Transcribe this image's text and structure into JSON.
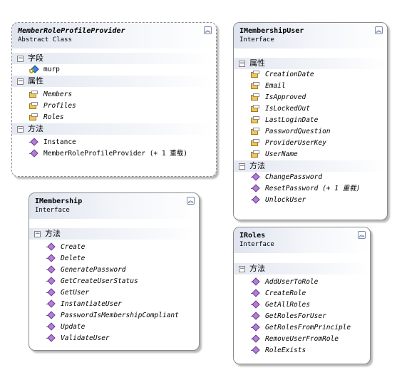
{
  "boxes": {
    "member_role_profile_provider": {
      "title": "MemberRoleProfileProvider",
      "subtitle": "Abstract Class",
      "collapse_glyph": "︽",
      "fields_label": "字段",
      "fields": [
        "murp"
      ],
      "properties_label": "属性",
      "properties": [
        "Members",
        "Profiles",
        "Roles"
      ],
      "methods_label": "方法",
      "methods": [
        "Instance",
        "MemberRoleProfileProvider (+ 1 重载)"
      ]
    },
    "imembership_user": {
      "title": "IMembershipUser",
      "subtitle": "Interface",
      "collapse_glyph": "︽",
      "properties_label": "属性",
      "properties": [
        "CreationDate",
        "Email",
        "IsApproved",
        "IsLockedOut",
        "LastLoginDate",
        "PasswordQuestion",
        "ProviderUserKey",
        "UserName"
      ],
      "methods_label": "方法",
      "methods": [
        "ChangePassword",
        "ResetPassword (+ 1 重载)",
        "UnlockUser"
      ]
    },
    "imembership": {
      "title": "IMembership",
      "subtitle": "Interface",
      "collapse_glyph": "︽",
      "methods_label": "方法",
      "methods": [
        "Create",
        "Delete",
        "GeneratePassword",
        "GetCreateUserStatus",
        "GetUser",
        "InstantiateUser",
        "PasswordIsMembershipCompliant",
        "Update",
        "ValidateUser"
      ]
    },
    "iroles": {
      "title": "IRoles",
      "subtitle": "Interface",
      "collapse_glyph": "︽",
      "methods_label": "方法",
      "methods": [
        "AddUserToRole",
        "CreateRole",
        "GetAllRoles",
        "GetRolesForUser",
        "GetRolesFromPrinciple",
        "RemoveUserFromRole",
        "RoleExists"
      ]
    }
  },
  "section_toggle_glyph": "−",
  "icons": {
    "field": "field-icon",
    "property": "property-icon",
    "method": "method-icon"
  },
  "colors": {
    "header_gradient_start": "#dfe4ef",
    "method_icon": "#b27fd6",
    "property_icon": "#f1c55a",
    "field_icon": "#3a8ad8"
  }
}
